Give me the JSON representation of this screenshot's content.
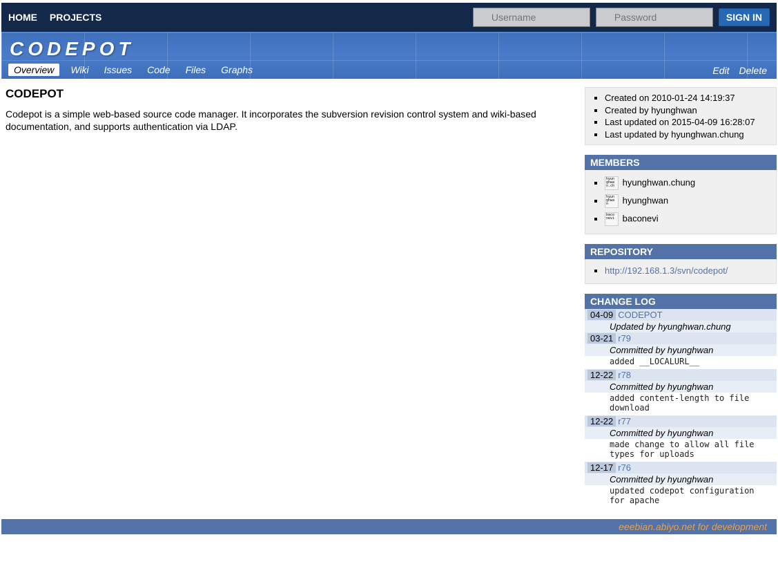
{
  "topnav": {
    "home": "HOME",
    "projects": "PROJECTS"
  },
  "login": {
    "username_placeholder": "Username",
    "password_placeholder": "Password",
    "signin": "SIGN IN"
  },
  "header": {
    "title": "CODEPOT"
  },
  "tabs": {
    "overview": "Overview",
    "wiki": "Wiki",
    "issues": "Issues",
    "code": "Code",
    "files": "Files",
    "graphs": "Graphs"
  },
  "actions": {
    "edit": "Edit",
    "delete": "Delete"
  },
  "page": {
    "title": "CODEPOT",
    "description": "Codepot is a simple web-based source code manager. It incorporates the subversion revision control system and wiki-based documentation, and supports authentication via LDAP."
  },
  "info": {
    "created_on": "Created on 2010-01-24 14:19:37",
    "created_by": "Created by hyunghwan",
    "updated_on": "Last updated on 2015-04-09 16:28:07",
    "updated_by": "Last updated by hyunghwan.chung"
  },
  "members": {
    "heading": "MEMBERS",
    "list": [
      {
        "name": "hyunghwan.chung",
        "av": "hyun ghwa n.ch"
      },
      {
        "name": "hyunghwan",
        "av": "hyun ghwa n"
      },
      {
        "name": "baconevi",
        "av": "baco nevi"
      }
    ]
  },
  "repository": {
    "heading": "REPOSITORY",
    "url": "http://192.168.1.3/svn/codepot/"
  },
  "changelog": {
    "heading": "CHANGE LOG",
    "items": [
      {
        "date": "04-09",
        "rev": "CODEPOT",
        "committer": "Updated by hyunghwan.chung",
        "msg": ""
      },
      {
        "date": "03-21",
        "rev": "r79",
        "committer": "Committed by hyunghwan",
        "msg": "added __LOCALURL__"
      },
      {
        "date": "12-22",
        "rev": "r78",
        "committer": "Committed by hyunghwan",
        "msg": "added content-length to file download"
      },
      {
        "date": "12-22",
        "rev": "r77",
        "committer": "Committed by hyunghwan",
        "msg": "made change to allow all file types for uploads"
      },
      {
        "date": "12-17",
        "rev": "r76",
        "committer": "Committed by hyunghwan",
        "msg": "updated codepot configuration for apache"
      }
    ]
  },
  "footer": "eeebian.abiyo.net for development"
}
